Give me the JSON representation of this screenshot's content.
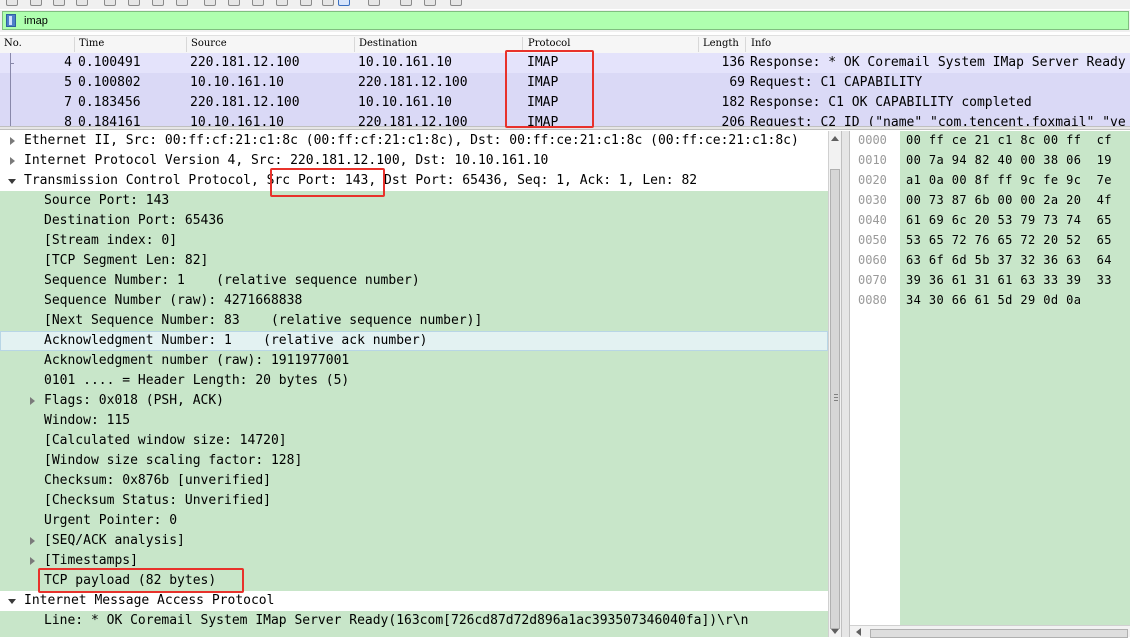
{
  "filter": {
    "value": "imap"
  },
  "packet_list": {
    "columns": [
      "No.",
      "Time",
      "Source",
      "Destination",
      "Protocol",
      "Length",
      "Info"
    ],
    "rows": [
      {
        "no": "4",
        "time": "0.100491",
        "source": "220.181.12.100",
        "destination": "10.10.161.10",
        "protocol": "IMAP",
        "length": "136",
        "info": "Response: * OK Coremail System IMap Server Ready"
      },
      {
        "no": "5",
        "time": "0.100802",
        "source": "10.10.161.10",
        "destination": "220.181.12.100",
        "protocol": "IMAP",
        "length": "69",
        "info": "Request: C1 CAPABILITY"
      },
      {
        "no": "7",
        "time": "0.183456",
        "source": "220.181.12.100",
        "destination": "10.10.161.10",
        "protocol": "IMAP",
        "length": "182",
        "info": "Response: C1 OK CAPABILITY completed"
      },
      {
        "no": "8",
        "time": "0.184161",
        "source": "10.10.161.10",
        "destination": "220.181.12.100",
        "protocol": "IMAP",
        "length": "206",
        "info": "Request: C2 ID (\"name\" \"com.tencent.foxmail\" \"ve"
      }
    ]
  },
  "details": {
    "ethernet": "Ethernet II, Src: 00:ff:cf:21:c1:8c (00:ff:cf:21:c1:8c), Dst: 00:ff:ce:21:c1:8c (00:ff:ce:21:c1:8c)",
    "ip": "Internet Protocol Version 4, Src: 220.181.12.100, Dst: 10.10.161.10",
    "tcp_prefix": "Transmission Control Protocol, ",
    "tcp_src_port": "Src Port: 143",
    "tcp_suffix": ", Dst Port: 65436, Seq: 1, Ack: 1, Len: 82",
    "tcp_fields": [
      "Source Port: 143",
      "Destination Port: 65436",
      "[Stream index: 0]",
      "[TCP Segment Len: 82]",
      "Sequence Number: 1    (relative sequence number)",
      "Sequence Number (raw): 4271668838",
      "[Next Sequence Number: 83    (relative sequence number)]",
      "Acknowledgment Number: 1    (relative ack number)",
      "Acknowledgment number (raw): 1911977001",
      "0101 .... = Header Length: 20 bytes (5)",
      "Flags: 0x018 (PSH, ACK)",
      "Window: 115",
      "[Calculated window size: 14720]",
      "[Window size scaling factor: 128]",
      "Checksum: 0x876b [unverified]",
      "[Checksum Status: Unverified]",
      "Urgent Pointer: 0",
      "[SEQ/ACK analysis]",
      "[Timestamps]",
      "TCP payload (82 bytes)"
    ],
    "imap": "Internet Message Access Protocol",
    "imap_line": "Line: * OK Coremail System IMap Server Ready(163com[726cd87d72d896a1ac393507346040fa])\\r\\n"
  },
  "hex": {
    "rows": [
      {
        "offset": "0000",
        "bytes": "00 ff ce 21 c1 8c 00 ff  cf"
      },
      {
        "offset": "0010",
        "bytes": "00 7a 94 82 40 00 38 06  19"
      },
      {
        "offset": "0020",
        "bytes": "a1 0a 00 8f ff 9c fe 9c  7e"
      },
      {
        "offset": "0030",
        "bytes": "00 73 87 6b 00 00 2a 20  4f"
      },
      {
        "offset": "0040",
        "bytes": "61 69 6c 20 53 79 73 74  65"
      },
      {
        "offset": "0050",
        "bytes": "53 65 72 76 65 72 20 52  65"
      },
      {
        "offset": "0060",
        "bytes": "63 6f 6d 5b 37 32 36 63  64"
      },
      {
        "offset": "0070",
        "bytes": "39 36 61 31 61 63 33 39  33"
      },
      {
        "offset": "0080",
        "bytes": "34 30 66 61 5d 29 0d 0a"
      }
    ]
  }
}
